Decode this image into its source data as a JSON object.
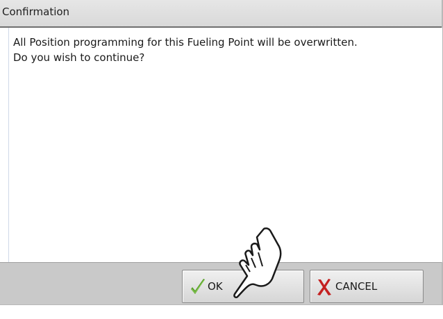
{
  "dialog": {
    "title": "Confirmation",
    "message_line1": "All Position programming for this Fueling Point will be overwritten.",
    "message_line2": "Do you wish to continue?"
  },
  "buttons": {
    "ok_label": "OK",
    "ok_icon": "check-icon",
    "cancel_label": "CANCEL",
    "cancel_icon": "x-icon"
  },
  "overlay": {
    "pointer_icon": "hand-pointer-icon"
  },
  "colors": {
    "check": "#5aa02c",
    "x": "#c42020",
    "titlebar": "#dedede",
    "footer": "#c9c9c9"
  }
}
